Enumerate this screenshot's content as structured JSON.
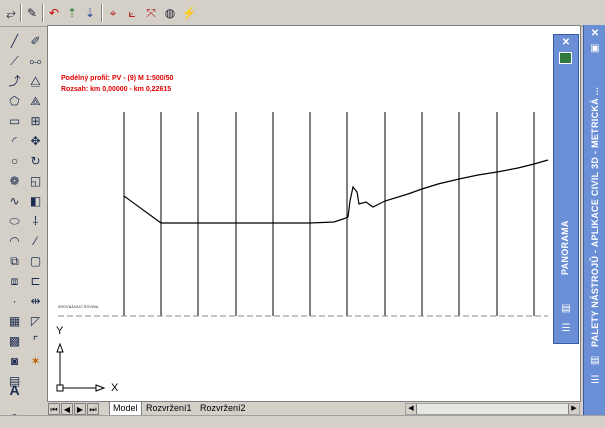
{
  "drawing": {
    "title_line1": "Podélný profil: PV - (9) M 1:500/50",
    "title_line2": "Rozsah: km 0,00000 - km 0,22615",
    "small_note": "SROVNÁVACÍ ROVINA",
    "ucs_y_label": "Y",
    "ucs_x_label": "X"
  },
  "tabs": {
    "model": "Model",
    "layout1": "Rozvržení1",
    "layout2": "Rozvržení2"
  },
  "palettes": {
    "panorama_title": "PANORAMA",
    "tool_palettes_title": "PALETY NÁSTROJŮ - APLIKACE CIVIL 3D - METRICKÁ ..."
  },
  "icons": {
    "top_toolbar": [
      "regen-icon",
      "edit-polyline-icon",
      "undo-arrow-icon",
      "grip-up-icon",
      "grip-down-icon",
      "ucs-origin-icon",
      "ucs-3point-icon",
      "ucs-axis-icon",
      "orbit-icon",
      "flashlight-icon"
    ],
    "left_toolbar_1": [
      "line-icon",
      "construction-line-icon",
      "polyline-icon",
      "polygon-icon",
      "rectangle-icon",
      "arc-icon",
      "circle-icon",
      "revision-cloud-icon",
      "spline-icon",
      "ellipse-icon",
      "ellipse-arc-icon",
      "insert-block-icon",
      "make-block-icon",
      "point-icon",
      "hatch-icon",
      "gradient-icon",
      "region-icon",
      "table-icon",
      "mtext-icon"
    ],
    "left_toolbar_2": [
      "erase-icon",
      "copy-icon",
      "mirror-icon",
      "offset-icon",
      "array-icon",
      "move-icon",
      "rotate-icon",
      "scale-icon",
      "stretch-icon",
      "trim-icon",
      "extend-icon",
      "break-point-icon",
      "break-icon",
      "join-icon",
      "chamfer-icon",
      "fillet-icon",
      "explode-icon"
    ]
  },
  "colors": {
    "title_red": "#e00000",
    "palette_blue": "#6b8fd6",
    "canvas_white": "#ffffff"
  }
}
